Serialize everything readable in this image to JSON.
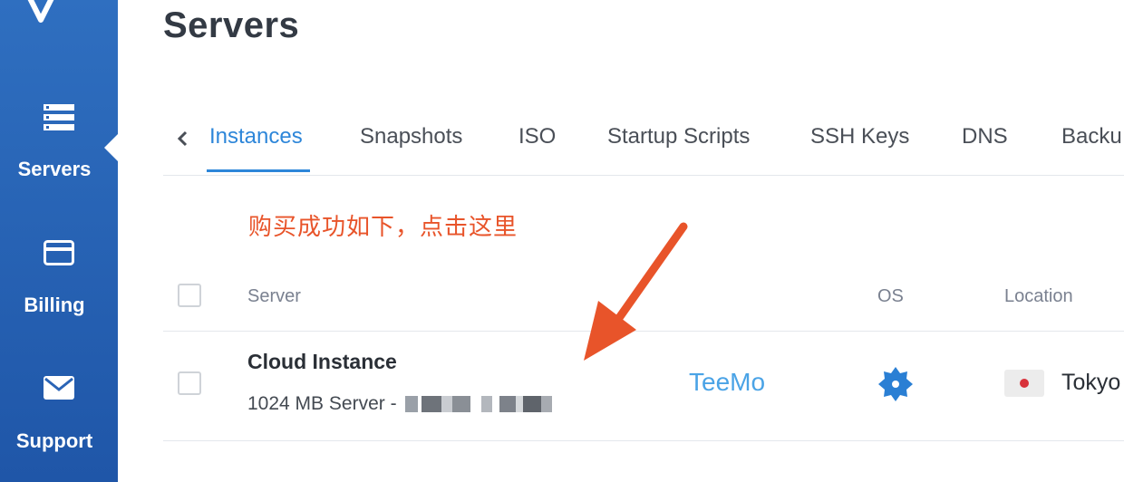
{
  "app": {
    "title": "Servers"
  },
  "sidebar": {
    "items": [
      {
        "label": "Servers",
        "icon": "servers-icon",
        "active": true
      },
      {
        "label": "Billing",
        "icon": "credit-card-icon",
        "active": false
      },
      {
        "label": "Support",
        "icon": "envelope-icon",
        "active": false
      }
    ],
    "background": "#2a64b6"
  },
  "tabs": [
    {
      "label": "Instances",
      "active": true
    },
    {
      "label": "Snapshots",
      "active": false
    },
    {
      "label": "ISO",
      "active": false
    },
    {
      "label": "Startup Scripts",
      "active": false
    },
    {
      "label": "SSH Keys",
      "active": false
    },
    {
      "label": "DNS",
      "active": false
    },
    {
      "label": "Backu",
      "active": false
    }
  ],
  "annotation": {
    "text": "购买成功如下，点击这里",
    "color": "#e8542a"
  },
  "table": {
    "columns": [
      "Server",
      "OS",
      "Location"
    ],
    "rows": [
      {
        "name": "Cloud Instance",
        "subtitle": "1024 MB Server - ",
        "label": "TeeMo",
        "os_icon": "os-gear-icon",
        "location": "Tokyo",
        "flag": "japan-flag-icon"
      }
    ]
  },
  "colors": {
    "accent": "#2d86d9",
    "link": "#4aa3e6",
    "annotation": "#e8542a"
  }
}
